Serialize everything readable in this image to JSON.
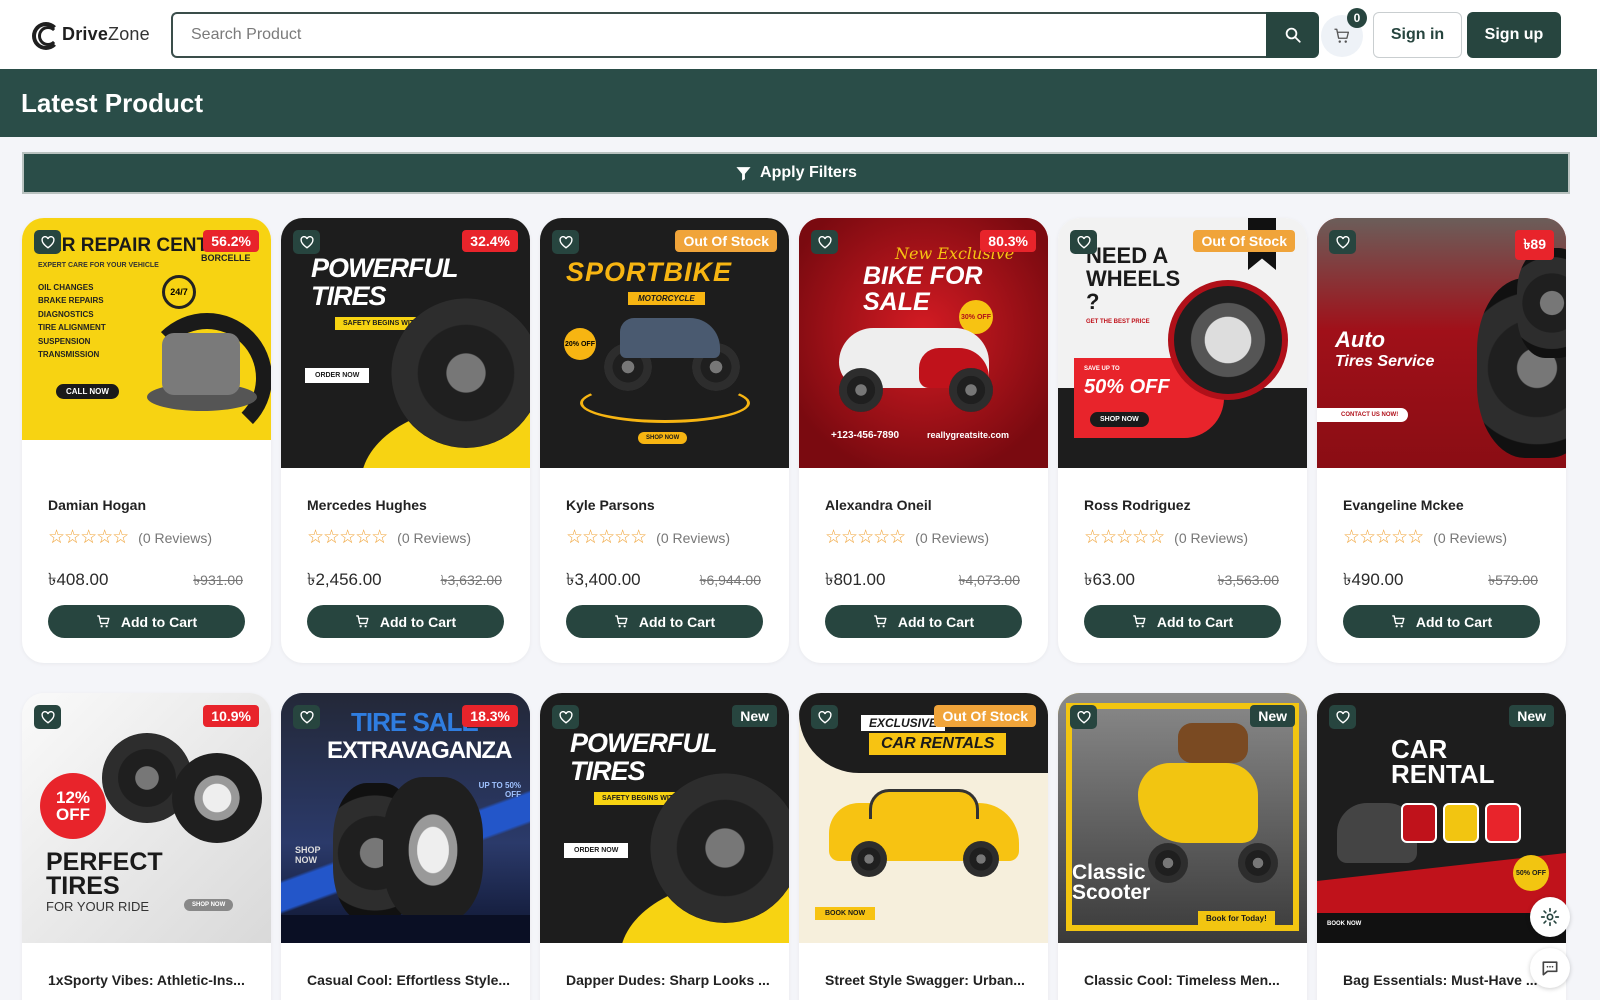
{
  "brand": {
    "name_bold": "Drive",
    "name_light": "Zone"
  },
  "search": {
    "placeholder": "Search Product",
    "value": ""
  },
  "cart": {
    "count": "0"
  },
  "auth": {
    "signin_label": "Sign in",
    "signup_label": "Sign up"
  },
  "page": {
    "title": "Latest Product",
    "filters_label": "Apply Filters"
  },
  "colors": {
    "primary": "#27453f",
    "sale": "#e8242b",
    "out_of_stock": "#f0a43a",
    "star": "#f0a43a"
  },
  "products": [
    {
      "name": "Damian Hogan",
      "badge": "56.2%",
      "badge_type": "sale",
      "reviews": "(0 Reviews)",
      "price": "৳408.00",
      "old_price": "৳931.00",
      "cta": "Add to Cart",
      "art": {
        "title": "AR REPAIR CENTER",
        "subtitle": "EXPERT CARE FOR YOUR VEHICLE",
        "brand": "BORCELLE",
        "list": [
          "OIL CHANGES",
          "BRAKE REPAIRS",
          "DIAGNOSTICS",
          "TIRE ALIGNMENT",
          "SUSPENSION",
          "TRANSMISSION"
        ],
        "cta": "CALL NOW",
        "badge": "24/7"
      }
    },
    {
      "name": "Mercedes Hughes",
      "badge": "32.4%",
      "badge_type": "sale",
      "reviews": "(0 Reviews)",
      "price": "৳2,456.00",
      "old_price": "৳3,632.00",
      "cta": "Add to Cart",
      "art": {
        "title": "POWERFUL TIRES",
        "subtitle": "SAFETY BEGINS WITH GOOD TIRES",
        "cta": "ORDER NOW"
      }
    },
    {
      "name": "Kyle Parsons",
      "badge": "Out Of Stock",
      "badge_type": "out",
      "reviews": "(0 Reviews)",
      "price": "৳3,400.00",
      "old_price": "৳6,944.00",
      "cta": "Add to Cart",
      "art": {
        "title": "SPORTBIKE",
        "subtitle": "MOTORCYCLE",
        "badge": "20% OFF",
        "cta": "SHOP NOW"
      }
    },
    {
      "name": "Alexandra Oneil",
      "badge": "80.3%",
      "badge_type": "sale",
      "reviews": "(0 Reviews)",
      "price": "৳801.00",
      "old_price": "৳4,073.00",
      "cta": "Add to Cart",
      "art": {
        "script": "New Exclusive",
        "title": "BIKE FOR SALE",
        "badge": "30% OFF",
        "phone": "+123-456-7890",
        "site": "reallygreatsite.com"
      }
    },
    {
      "name": "Ross Rodriguez",
      "badge": "Out Of Stock",
      "badge_type": "out",
      "reviews": "(0 Reviews)",
      "price": "৳63.00",
      "old_price": "৳3,563.00",
      "cta": "Add to Cart",
      "art": {
        "title": "NEED A WHEELS ?",
        "subtitle": "GET THE BEST PRICE",
        "save": "SAVE UP TO",
        "offer": "50% OFF",
        "cta": "SHOP NOW"
      }
    },
    {
      "name": "Evangeline Mckee",
      "badge": "৳89",
      "badge_type": "sale",
      "reviews": "(0 Reviews)",
      "price": "৳490.00",
      "old_price": "৳579.00",
      "cta": "Add to Cart",
      "art": {
        "title": "Auto",
        "title2": "Tires Service",
        "cta": "CONTACT US NOW!"
      }
    },
    {
      "name": "1xSporty Vibes: Athletic-Ins...",
      "badge": "10.9%",
      "badge_type": "sale",
      "art": {
        "badge": "12% OFF",
        "title": "PERFECT TIRES",
        "subtitle": "FOR YOUR RIDE",
        "cta": "SHOP NOW"
      }
    },
    {
      "name": "Casual Cool: Effortless Style...",
      "badge": "18.3%",
      "badge_type": "sale",
      "art": {
        "title": "TIRE SALE",
        "title2": "EXTRAVAGANZA",
        "offer": "UP TO 50% OFF",
        "cta": "SHOP NOW"
      }
    },
    {
      "name": "Dapper Dudes: Sharp Looks ...",
      "badge": "New",
      "badge_type": "new",
      "art": {
        "title": "POWERFUL TIRES",
        "subtitle": "SAFETY BEGINS WITH GOOD TIRES",
        "cta": "ORDER NOW"
      }
    },
    {
      "name": "Street Style Swagger: Urban...",
      "badge": "Out Of Stock",
      "badge_type": "out",
      "art": {
        "title": "EXCLUSIVE",
        "title2": "CAR RENTALS",
        "cta": "BOOK NOW"
      }
    },
    {
      "name": "Classic Cool: Timeless Men...",
      "badge": "New",
      "badge_type": "new",
      "art": {
        "title": "Classic",
        "title2": "Scooter",
        "cta": "Book for Today!"
      }
    },
    {
      "name": "Bag Essentials: Must-Have ...",
      "badge": "New",
      "badge_type": "new",
      "art": {
        "title": "CAR",
        "title2": "RENTAL",
        "offer": "50% OFF",
        "cta": "BOOK NOW"
      }
    }
  ]
}
